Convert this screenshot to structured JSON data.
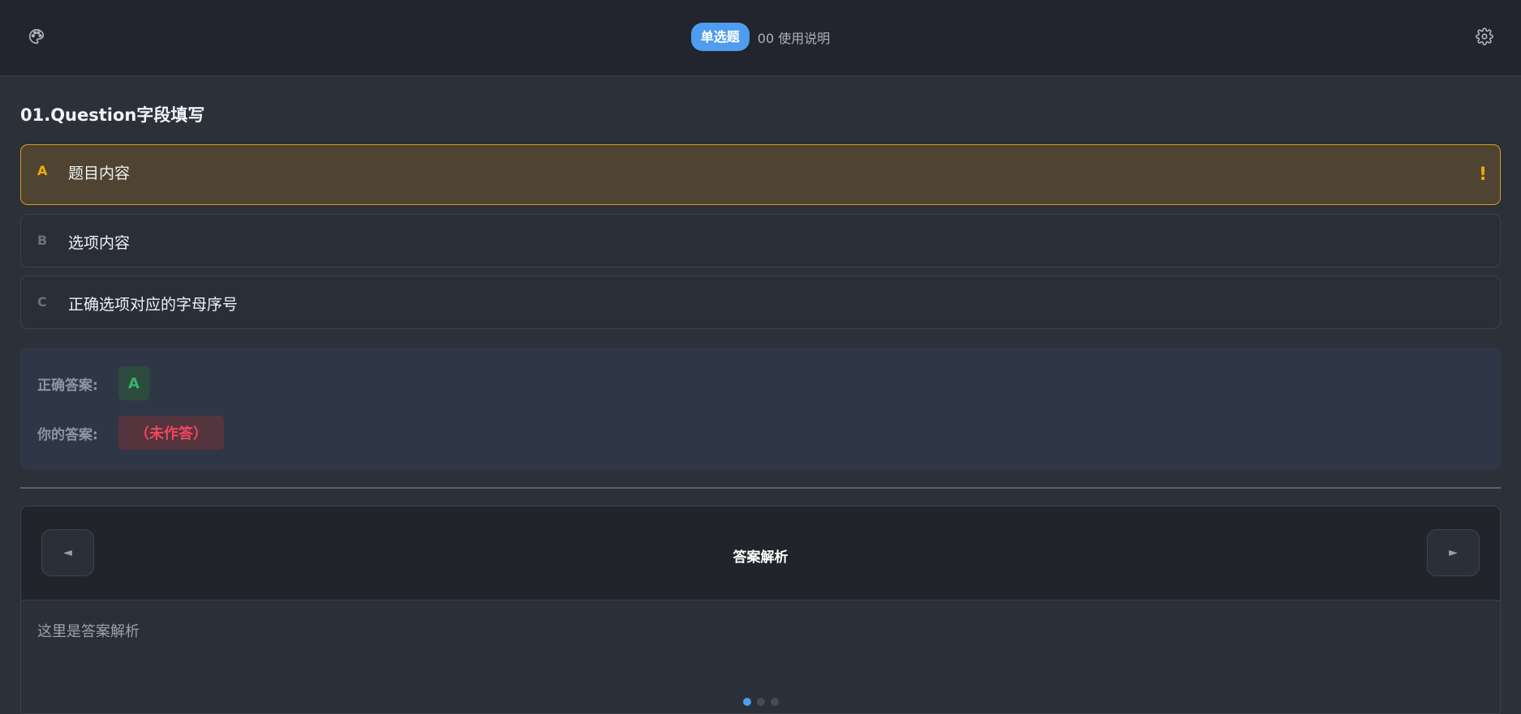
{
  "header": {
    "question_type": "单选题",
    "guide_link": "00 使用说明",
    "left_icon": "palette-icon",
    "right_icon": "gear-icon"
  },
  "question": {
    "title": "01.Question字段填写",
    "options": [
      {
        "letter": "A",
        "text": "题目内容",
        "selected": true
      },
      {
        "letter": "B",
        "text": "选项内容",
        "selected": false
      },
      {
        "letter": "C",
        "text": "正确选项对应的字母序号",
        "selected": false
      }
    ],
    "selected_warning": "!"
  },
  "answers": {
    "correct_label": "正确答案:",
    "correct_value": "A",
    "yours_label": "你的答案:",
    "yours_value": "（未作答）"
  },
  "analysis": {
    "title": "答案解析",
    "body": "这里是答案解析",
    "prev_glyph": "◄",
    "next_glyph": "►",
    "pages": 3,
    "active_page": 1
  },
  "colors": {
    "accent": "#4f9cf0",
    "warning": "#f0a80e",
    "success": "#34b56a",
    "danger": "#f2465a"
  }
}
